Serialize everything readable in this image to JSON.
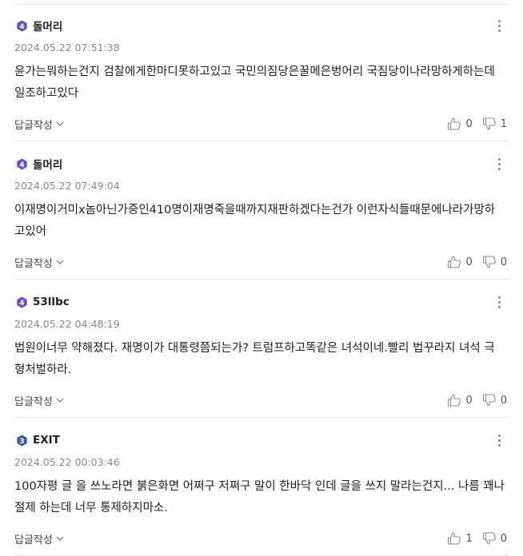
{
  "reply_label": "답글작성",
  "comments": [
    {
      "badge": "4",
      "badge_color": "#6b4fbb",
      "author": "돌머리",
      "timestamp": "2024.05.22 07:51:38",
      "text": "윤가는뭐하는건지 검찰에게한마디못하고있고 국민의짐당은꿀메은벙어리 국짐당이나라망하게하는데일조하고있다",
      "likes": "0",
      "dislikes": "1"
    },
    {
      "badge": "4",
      "badge_color": "#6b4fbb",
      "author": "돌머리",
      "timestamp": "2024.05.22 07:49:04",
      "text": "이재명이거미x놈아닌가증인410명이재명죽을때까지재판하겠다는건가 이런자식들때문에나라가망하고있어",
      "likes": "0",
      "dislikes": "0"
    },
    {
      "badge": "4",
      "badge_color": "#6b4fbb",
      "author": "53llbc",
      "timestamp": "2024.05.22 04:48:19",
      "text": "법원이너무 약해졌다. 재명이가 대통령쯤되는가? 트럼프하고똑같은 녀석이네.빨리 법꾸라지 녀석 극형처벌하라.",
      "likes": "0",
      "dislikes": "0"
    },
    {
      "badge": "3",
      "badge_color": "#3d5a9e",
      "author": "EXIT",
      "timestamp": "2024.05.22 00:03:46",
      "text": "100자평 글 을 쓰노라면 붉은화면 어쩌구 저쩌구 말이 한바닥 인데 글을 쓰지 말라는건지... 나름 꽤나 절제 하는데 너무 통제하지마소.",
      "likes": "1",
      "dislikes": "0"
    }
  ]
}
